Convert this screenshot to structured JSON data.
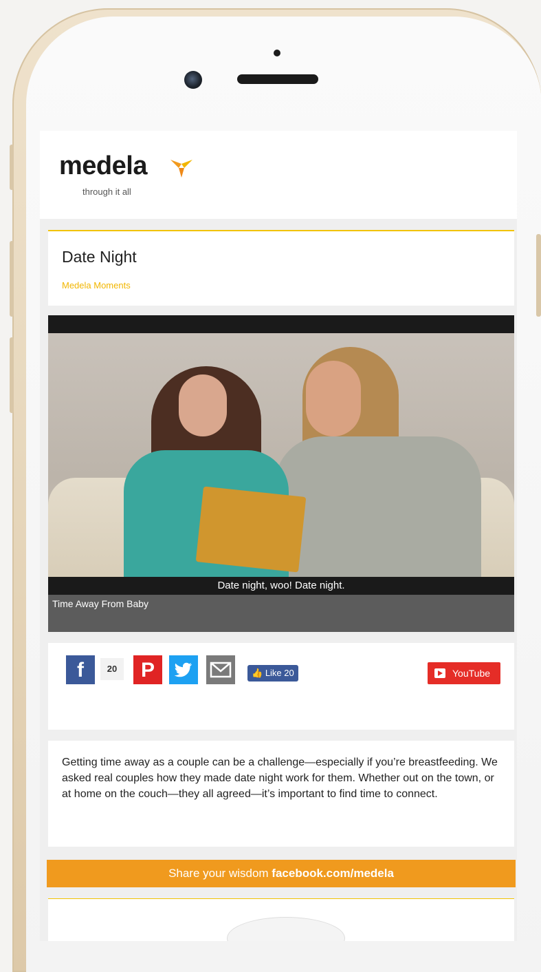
{
  "brand": {
    "name": "medela",
    "tagline": "through it all"
  },
  "article": {
    "title": "Date Night",
    "category": "Medela Moments"
  },
  "video": {
    "caption": "Date night, woo! Date night.",
    "title": "Time Away From Baby"
  },
  "share": {
    "facebook_count": "20",
    "like_label": "Like 20",
    "youtube_label": "YouTube"
  },
  "body": {
    "text": "Getting time away as a couple can be a challenge—especially if you’re breastfeeding. We asked real couples how they made date night work for them. Whether out on the town, or at home on the couch—they all agreed—it’s important to find time to connect."
  },
  "cta": {
    "prefix": "Share your wisdom ",
    "link": "facebook.com/medela"
  },
  "colors": {
    "accent": "#f2c300",
    "cta": "#f09a1e",
    "facebook": "#3b5999",
    "pinterest": "#e02424",
    "twitter": "#1da1f2",
    "youtube": "#e52d27"
  },
  "icons": [
    "facebook-icon",
    "pinterest-icon",
    "twitter-icon",
    "mail-icon",
    "thumbs-up-icon",
    "youtube-play-icon",
    "medela-logo-icon"
  ]
}
